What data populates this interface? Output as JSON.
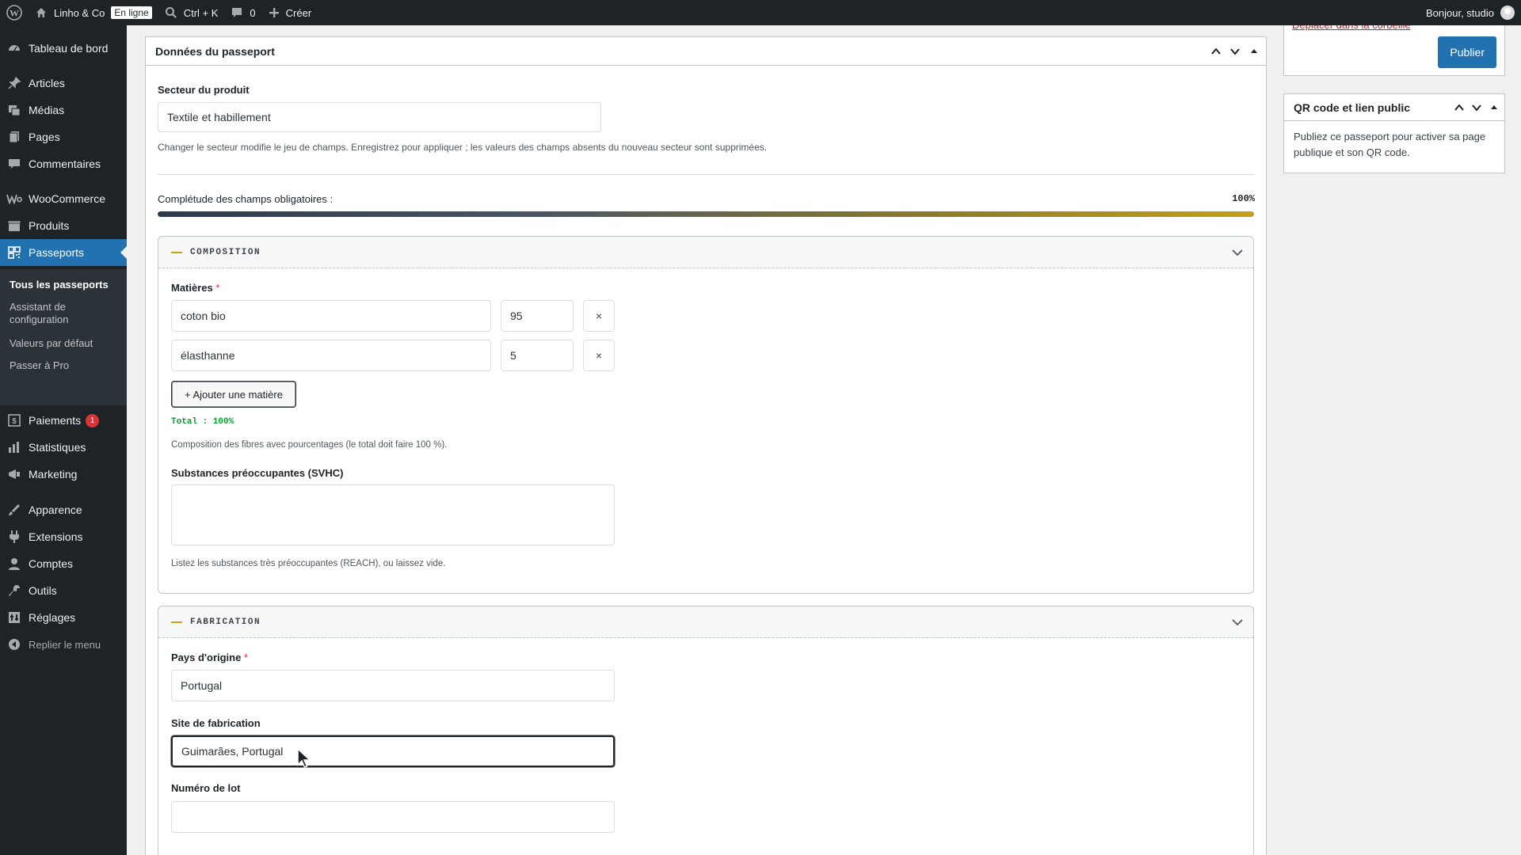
{
  "admin_bar": {
    "site_name": "Linho & Co",
    "online_badge": "En ligne",
    "search_shortcut": "Ctrl + K",
    "comments_count": "0",
    "new_label": "Créer",
    "greeting": "Bonjour, studio"
  },
  "sidebar": {
    "items": [
      {
        "label": "Tableau de bord",
        "icon": "dashboard-icon"
      },
      {
        "label": "Articles",
        "icon": "pin-icon"
      },
      {
        "label": "Médias",
        "icon": "media-icon"
      },
      {
        "label": "Pages",
        "icon": "pages-icon"
      },
      {
        "label": "Commentaires",
        "icon": "comments-icon"
      },
      {
        "label": "WooCommerce",
        "icon": "woocommerce-icon"
      },
      {
        "label": "Produits",
        "icon": "products-icon"
      },
      {
        "label": "Passeports",
        "icon": "qr-icon"
      },
      {
        "label": "Paiements",
        "icon": "payments-icon",
        "badge": "1"
      },
      {
        "label": "Statistiques",
        "icon": "stats-icon"
      },
      {
        "label": "Marketing",
        "icon": "marketing-icon"
      },
      {
        "label": "Apparence",
        "icon": "appearance-icon"
      },
      {
        "label": "Extensions",
        "icon": "plugins-icon"
      },
      {
        "label": "Comptes",
        "icon": "users-icon"
      },
      {
        "label": "Outils",
        "icon": "tools-icon"
      },
      {
        "label": "Réglages",
        "icon": "settings-icon"
      }
    ],
    "submenu": [
      "Tous les passeports",
      "Assistant de configuration",
      "Valeurs par défaut",
      "Passer à Pro"
    ],
    "collapse_label": "Replier le menu"
  },
  "main": {
    "box_title": "Données du passeport",
    "sector": {
      "label": "Secteur du produit",
      "value": "Textile et habillement",
      "help": "Changer le secteur modifie le jeu de champs. Enregistrez pour appliquer ; les valeurs des champs absents du nouveau secteur sont supprimées."
    },
    "completeness": {
      "label": "Complétude des champs obligatoires :",
      "value_text": "100%",
      "value": 100
    },
    "composition": {
      "title": "COMPOSITION",
      "materials_label": "Matières",
      "required_mark": "*",
      "rows": [
        {
          "name": "coton bio",
          "percent": "95"
        },
        {
          "name": "élasthanne",
          "percent": "5"
        }
      ],
      "remove_symbol": "×",
      "add_button": "+ Ajouter une matière",
      "total": "Total : 100%",
      "help": "Composition des fibres avec pourcentages (le total doit faire 100 %).",
      "svhc_label": "Substances préoccupantes (SVHC)",
      "svhc_value": "",
      "svhc_help": "Listez les substances très préoccupantes (REACH), ou laissez vide."
    },
    "fabrication": {
      "title": "FABRICATION",
      "origin_label": "Pays d'origine",
      "required_mark": "*",
      "origin_value": "Portugal",
      "site_label": "Site de fabrication",
      "site_value": "Guimarães, Portugal",
      "lot_label": "Numéro de lot",
      "lot_value": ""
    }
  },
  "publish": {
    "trash_link": "Déplacer dans la corbeille",
    "publish_button": "Publier"
  },
  "qr_box": {
    "title": "QR code et lien public",
    "body": "Publiez ce passeport pour activer sa page publique et son QR code."
  },
  "colors": {
    "admin_bg": "#1d2327",
    "accent": "#2271b1",
    "progress_end": "#c4a018",
    "success": "#00a32a",
    "danger": "#d63638"
  }
}
